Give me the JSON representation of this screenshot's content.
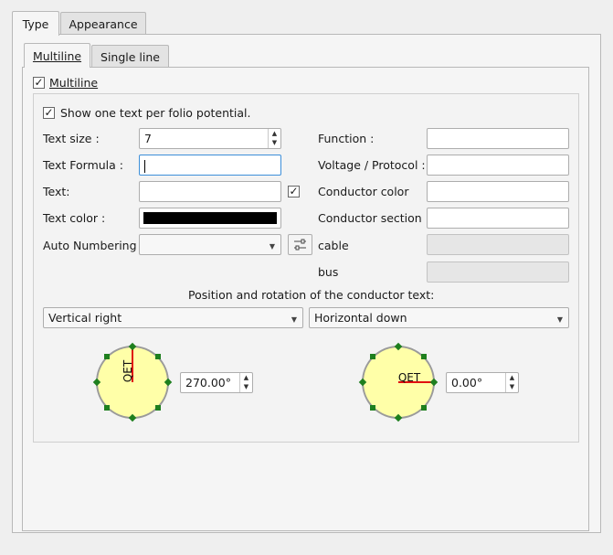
{
  "tabs": {
    "type": "Type",
    "appearance": "Appearance"
  },
  "subtabs": {
    "multiline": "Multiline",
    "single_line": "Single line"
  },
  "multiline_checkbox": {
    "label": "Multiline",
    "checked": "✓"
  },
  "show_one_text": {
    "label": "Show one text per folio potential.",
    "checked": "✓"
  },
  "fields": {
    "text_size_label": "Text size :",
    "text_size_value": "7",
    "text_formula_label": "Text Formula :",
    "text_label": "Text:",
    "text_checked": "✓",
    "text_color_label": "Text color :",
    "text_color_value": "#000000",
    "auto_numbering_label": "Auto Numbering",
    "function_label": "Function :",
    "voltage_label": "Voltage / Protocol :",
    "conductor_color_label": "Conductor color",
    "conductor_section_label": "Conductor section",
    "cable_label": "cable",
    "bus_label": "bus"
  },
  "position": {
    "heading": "Position and rotation of the conductor text:",
    "left_select": "Vertical right",
    "right_select": "Horizontal down",
    "left_dial_text": "QET",
    "right_dial_text": "QET",
    "left_angle": "270.00°",
    "right_angle": "0.00°"
  },
  "colors": {
    "accent": "#3d8fd9",
    "dial_fill": "#ffffa8",
    "handle": "#1e7f1e",
    "pointer": "#e01010"
  },
  "icons": {
    "spin": "spin-arrows-icon",
    "dropdown": "chevron-down-icon",
    "settings": "sliders-icon"
  }
}
